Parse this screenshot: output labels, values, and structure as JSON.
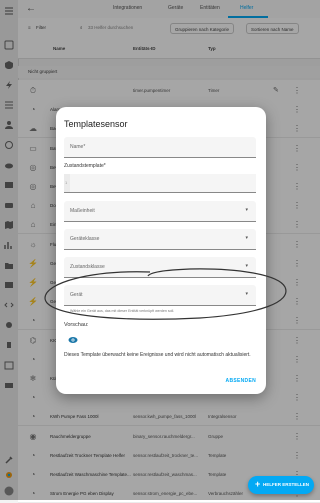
{
  "topbar": {
    "tabs": [
      {
        "label": "Integrationen"
      },
      {
        "label": "Geräte"
      },
      {
        "label": "Entitäten"
      },
      {
        "label": "Helfer"
      }
    ]
  },
  "toolbar": {
    "filter_label": "Filter",
    "search_placeholder": "33 Helfer durchsuchen",
    "group_label": "Gruppieren nach Kategorie",
    "sort_label": "Sortieren nach Name"
  },
  "table": {
    "columns": [
      "Name",
      "Entitäts-ID",
      "Typ"
    ],
    "group_label": "Nicht gruppiert",
    "rows": [
      {
        "name": "",
        "entity_id": "timer.pumpentimer",
        "type": "Timer"
      },
      {
        "name": "Alarm",
        "entity_id": "",
        "type": ""
      },
      {
        "name": "Backu",
        "entity_id": "",
        "type": ""
      },
      {
        "name": "Batter",
        "entity_id": "",
        "type": ""
      },
      {
        "name": "Bewe",
        "entity_id": "",
        "type": ""
      },
      {
        "name": "Bewe",
        "entity_id": "",
        "type": ""
      },
      {
        "name": "Dom",
        "entity_id": "",
        "type": ""
      },
      {
        "name": "Eingt",
        "entity_id": "",
        "type": ""
      },
      {
        "name": "Flutl",
        "entity_id": "",
        "type": ""
      },
      {
        "name": "Gesa",
        "entity_id": "",
        "type": ""
      },
      {
        "name": "Gesa",
        "entity_id": "",
        "type": ""
      },
      {
        "name": "Gesa",
        "entity_id": "",
        "type": ""
      },
      {
        "name": "",
        "entity_id": "",
        "type": ""
      },
      {
        "name": "KIGSt",
        "entity_id": "",
        "type": ""
      },
      {
        "name": "",
        "entity_id": "",
        "type": ""
      },
      {
        "name": "Kühlt",
        "entity_id": "",
        "type": ""
      },
      {
        "name": "",
        "entity_id": "",
        "type": ""
      },
      {
        "name": "KWh Pumpe Fass 1000l",
        "entity_id": "sensor.kwh_pumpe_fass_1000l",
        "type": "Integralsensor"
      },
      {
        "name": "Rauchmeldergruppe",
        "entity_id": "binary_sensor.rauchmeldergr...",
        "type": "Gruppe"
      },
      {
        "name": "Restlaufzeit Trockner Template Helfer",
        "entity_id": "sensor.restlaufzeit_trockner_te...",
        "type": "Template"
      },
      {
        "name": "Restlaufzeit Waschmaschine Template...",
        "entity_id": "sensor.restlaufzeit_waschmas...",
        "type": "Template"
      },
      {
        "name": "Strom Energie PG eben Display",
        "entity_id": "sensor.strom_energie_pc_ebe...",
        "type": "Verbrauchszähler"
      }
    ]
  },
  "dialog": {
    "title": "Templatesensor",
    "name_label": "Name*",
    "state_template_label": "Zustandstemplate*",
    "line_number": "1",
    "unit_label": "Maßeinheit",
    "device_class_label": "Geräteklasse",
    "state_class_label": "Zustandsklasse",
    "device_label": "Gerät",
    "device_helper": "Wähle ein Gerät aus, das mit dieser Entität verknüpft werden soll.",
    "preview_label": "Vorschau:",
    "preview_text": "Dieses Template überwacht keine Ereignisse und wird nicht automatisch aktualisiert.",
    "close_label": "ABSENDEN"
  },
  "fab": {
    "label": "HELFER ERSTELLEN"
  },
  "colors": {
    "accent": "#03a9f4"
  }
}
